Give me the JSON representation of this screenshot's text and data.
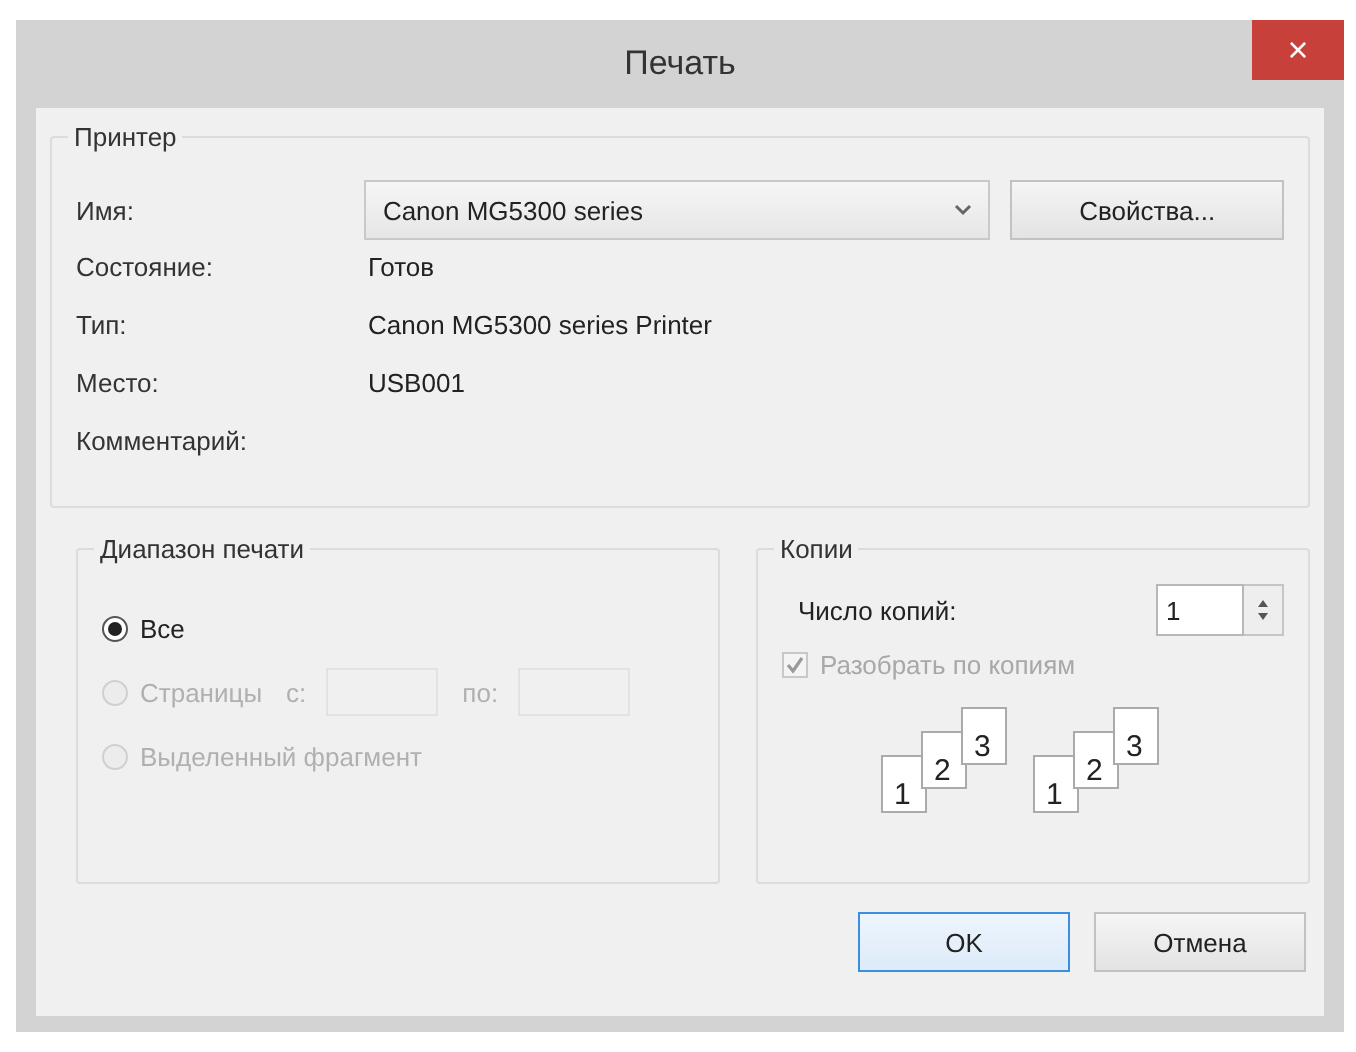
{
  "window": {
    "title": "Печать",
    "close": "×"
  },
  "printer": {
    "legend": "Принтер",
    "name_label": "Имя:",
    "name_value": "Canon MG5300 series",
    "properties_button": "Свойства...",
    "info": [
      {
        "label": "Состояние:",
        "value": "Готов"
      },
      {
        "label": "Тип:",
        "value": "Canon MG5300 series Printer"
      },
      {
        "label": "Место:",
        "value": "USB001"
      },
      {
        "label": "Комментарий:"
      }
    ]
  },
  "print_range": {
    "legend": "Диапазон печати",
    "options": [
      {
        "label": "Все",
        "selected": true,
        "disabled": false
      },
      {
        "label": "Страницы",
        "selected": false,
        "disabled": true,
        "from_label": "с:",
        "to_label": "по:"
      },
      {
        "label": "Выделенный фрагмент",
        "selected": false,
        "disabled": true
      }
    ]
  },
  "copies": {
    "legend": "Копии",
    "count_label": "Число копий:",
    "count": "1",
    "collate": {
      "label": "Разобрать по копиям",
      "checked": true,
      "disabled": true
    },
    "collate_stacks": [
      [
        "1",
        "2",
        "3"
      ],
      [
        "1",
        "2",
        "3"
      ]
    ]
  },
  "buttons": [
    {
      "label": "OK",
      "default": true
    },
    {
      "label": "Отмена",
      "default": false
    }
  ]
}
